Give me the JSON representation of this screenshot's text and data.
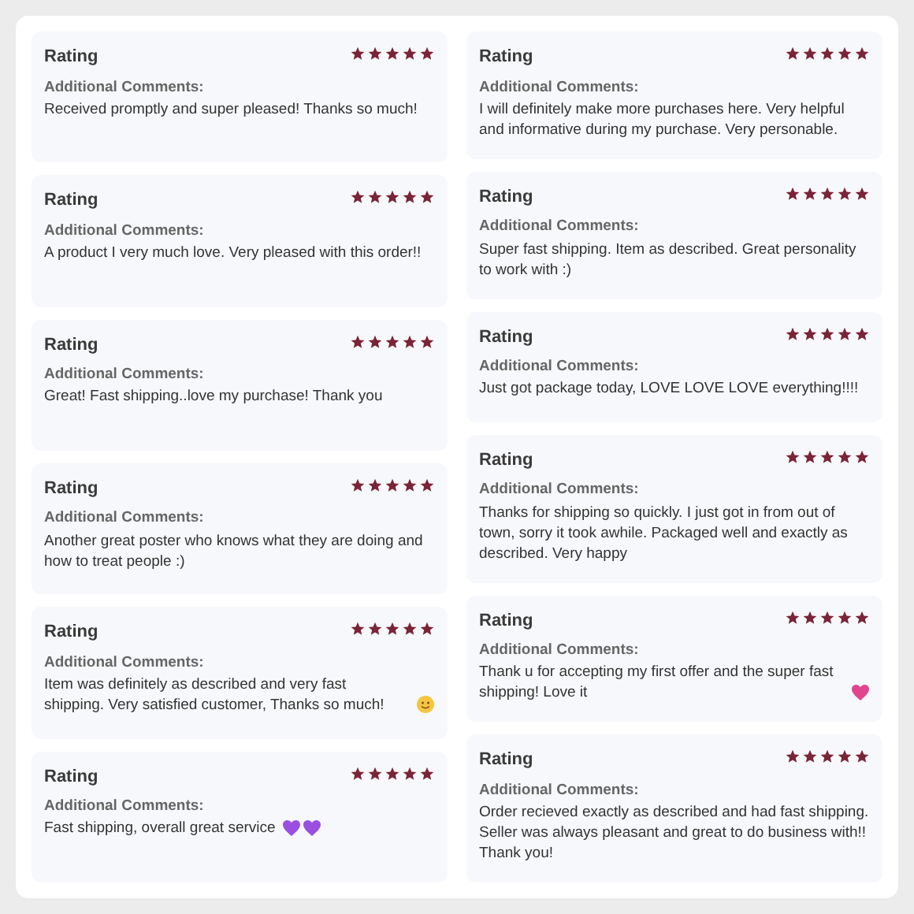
{
  "columns": [
    {
      "reviews": [
        {
          "label": "Rating",
          "stars": 5,
          "comments_label": "Additional Comments:",
          "comment": "Received promptly and super pleased! Thanks so much!",
          "kind": "plain"
        },
        {
          "label": "Rating",
          "stars": 5,
          "comments_label": "Additional Comments:",
          "comment": "A product I very much love. Very pleased with this order!!",
          "kind": "plain"
        },
        {
          "label": "Rating",
          "stars": 5,
          "comments_label": "Additional Comments:",
          "comment": "Great! Fast shipping..love my purchase! Thank you",
          "kind": "plain"
        },
        {
          "label": "Rating",
          "stars": 5,
          "comments_label": "Additional Comments:",
          "comment": "Another great poster who knows what they are doing and how to treat people :)",
          "kind": "plain"
        },
        {
          "label": "Rating",
          "stars": 5,
          "comments_label": "Additional Comments:",
          "comment": "Item was definitely as described and very fast shipping. Very satisfied customer, Thanks so much!",
          "kind": "smiley"
        },
        {
          "label": "Rating",
          "stars": 5,
          "comments_label": "Additional Comments:",
          "comment": "Fast shipping, overall great service",
          "kind": "hearts"
        }
      ]
    },
    {
      "reviews": [
        {
          "label": "Rating",
          "stars": 5,
          "comments_label": "Additional Comments:",
          "comment": "I will definitely make more purchases here. Very helpful and informative during my purchase. Very personable.",
          "kind": "plain"
        },
        {
          "label": "Rating",
          "stars": 5,
          "comments_label": "Additional Comments:",
          "comment": "Super fast shipping. Item as described. Great personality to work with :)",
          "kind": "plain"
        },
        {
          "label": "Rating",
          "stars": 5,
          "comments_label": "Additional Comments:",
          "comment": "Just got package today, LOVE LOVE LOVE everything!!!!",
          "kind": "plain"
        },
        {
          "label": "Rating",
          "stars": 5,
          "comments_label": "Additional Comments:",
          "comment": "Thanks for shipping so quickly. I just got in from out of town, sorry it took awhile. Packaged well and exactly as described. Very happy",
          "kind": "plain"
        },
        {
          "label": "Rating",
          "stars": 5,
          "comments_label": "Additional Comments:",
          "comment": "Thank u for accepting my first offer and the super fast shipping! Love it",
          "kind": "sparkle-heart"
        },
        {
          "label": "Rating",
          "stars": 5,
          "comments_label": "Additional Comments:",
          "comment": "Order recieved exactly as described and had fast shipping. Seller was always pleasant and great to do business with!! Thank you!",
          "kind": "plain"
        }
      ]
    }
  ]
}
